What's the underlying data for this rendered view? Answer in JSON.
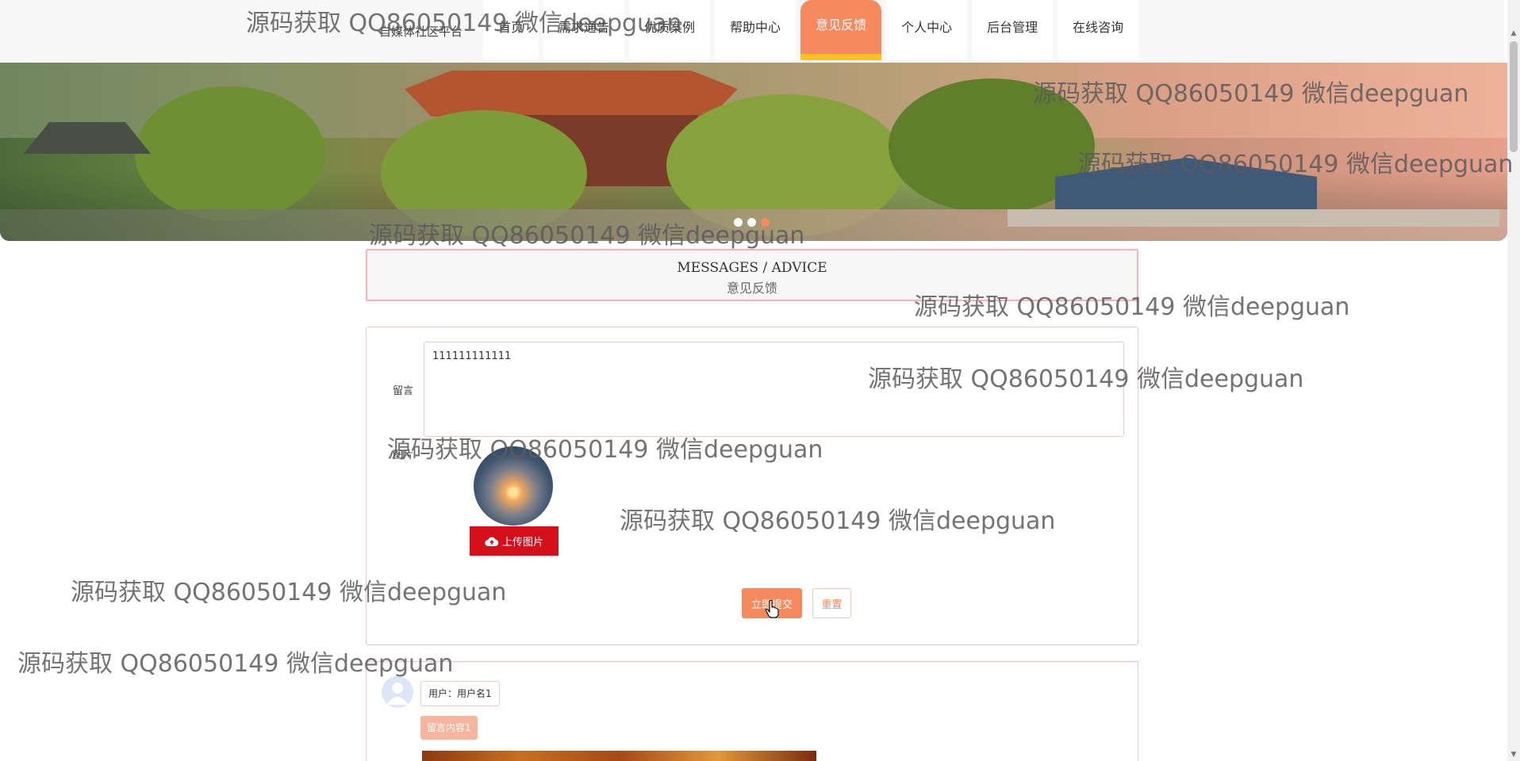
{
  "header": {
    "brand": "自媒体社区平台",
    "nav": [
      "首页",
      "需求通告",
      "优质案例",
      "帮助中心",
      "意见反馈",
      "个人中心",
      "后台管理",
      "在线咨询"
    ],
    "active_index": 4
  },
  "section": {
    "title_en": "MESSAGES / ADVICE",
    "title_zh": "意见反馈"
  },
  "form": {
    "message_label": "留言",
    "message_value": "111111111111",
    "image_label": "图片",
    "upload_label": "上传图片",
    "submit_label": "立即提交",
    "reset_label": "重置"
  },
  "comment": {
    "user_text": "用户：用户名1",
    "content_text": "留言内容1"
  },
  "watermark": "源码获取 QQ86050149 微信deepguan",
  "colors": {
    "accent": "#f58a5e",
    "active_underline": "#ffc21a",
    "upload_button": "#d4101b",
    "card_border": "#f3c2c4"
  }
}
